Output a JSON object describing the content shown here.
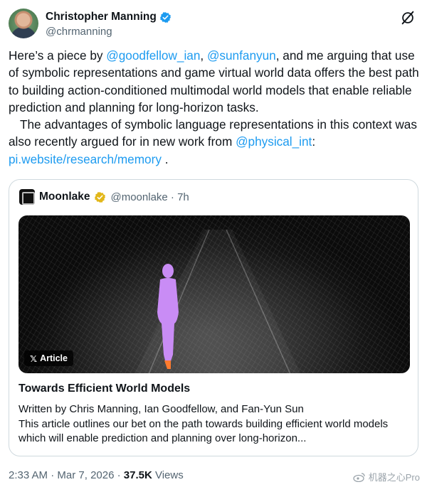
{
  "author": {
    "display_name": "Christopher Manning",
    "handle": "@chrmanning",
    "verified_icon": "verified-badge-icon",
    "avatar": "avatar"
  },
  "tweet": {
    "p1_prefix": "Here’s a piece by ",
    "mention1": "@goodfellow_ian",
    "p1_sep": ", ",
    "mention2": "@sunfanyun",
    "p1_rest": ", and me arguing that use of symbolic representations and game virtual world data offers the best path to building action-conditioned multimodal world models that enable reliable prediction and planning for long-horizon tasks.",
    "p2_prefix": "The advantages of symbolic language representations in this context was also recently argued for in new work from ",
    "mention3": "@physical_int",
    "p2_sep": ":",
    "link": "pi.website/research/memory",
    "p2_end": " ."
  },
  "quote": {
    "name": "Moonlake",
    "handle_time": "@moonlake · 7h",
    "badge_label": "Article",
    "title": "Towards Efficient World Models",
    "byline": "Written by Chris Manning, Ian Goodfellow, and Fan-Yun Sun",
    "description": "This article outlines our bet on the path towards building efficient world models which will enable prediction and planning over long-horizon..."
  },
  "footer": {
    "time": "2:33 AM",
    "sep1": " · ",
    "date": "Mar 7, 2026",
    "sep2": " · ",
    "views_count": "37.5K",
    "views_label": " Views"
  },
  "watermark": "机器之心Pro",
  "colors": {
    "accent": "#1d9bf0",
    "text": "#0f1419",
    "muted": "#536471",
    "border": "#cfd9de",
    "figure": "#c98cf5"
  }
}
